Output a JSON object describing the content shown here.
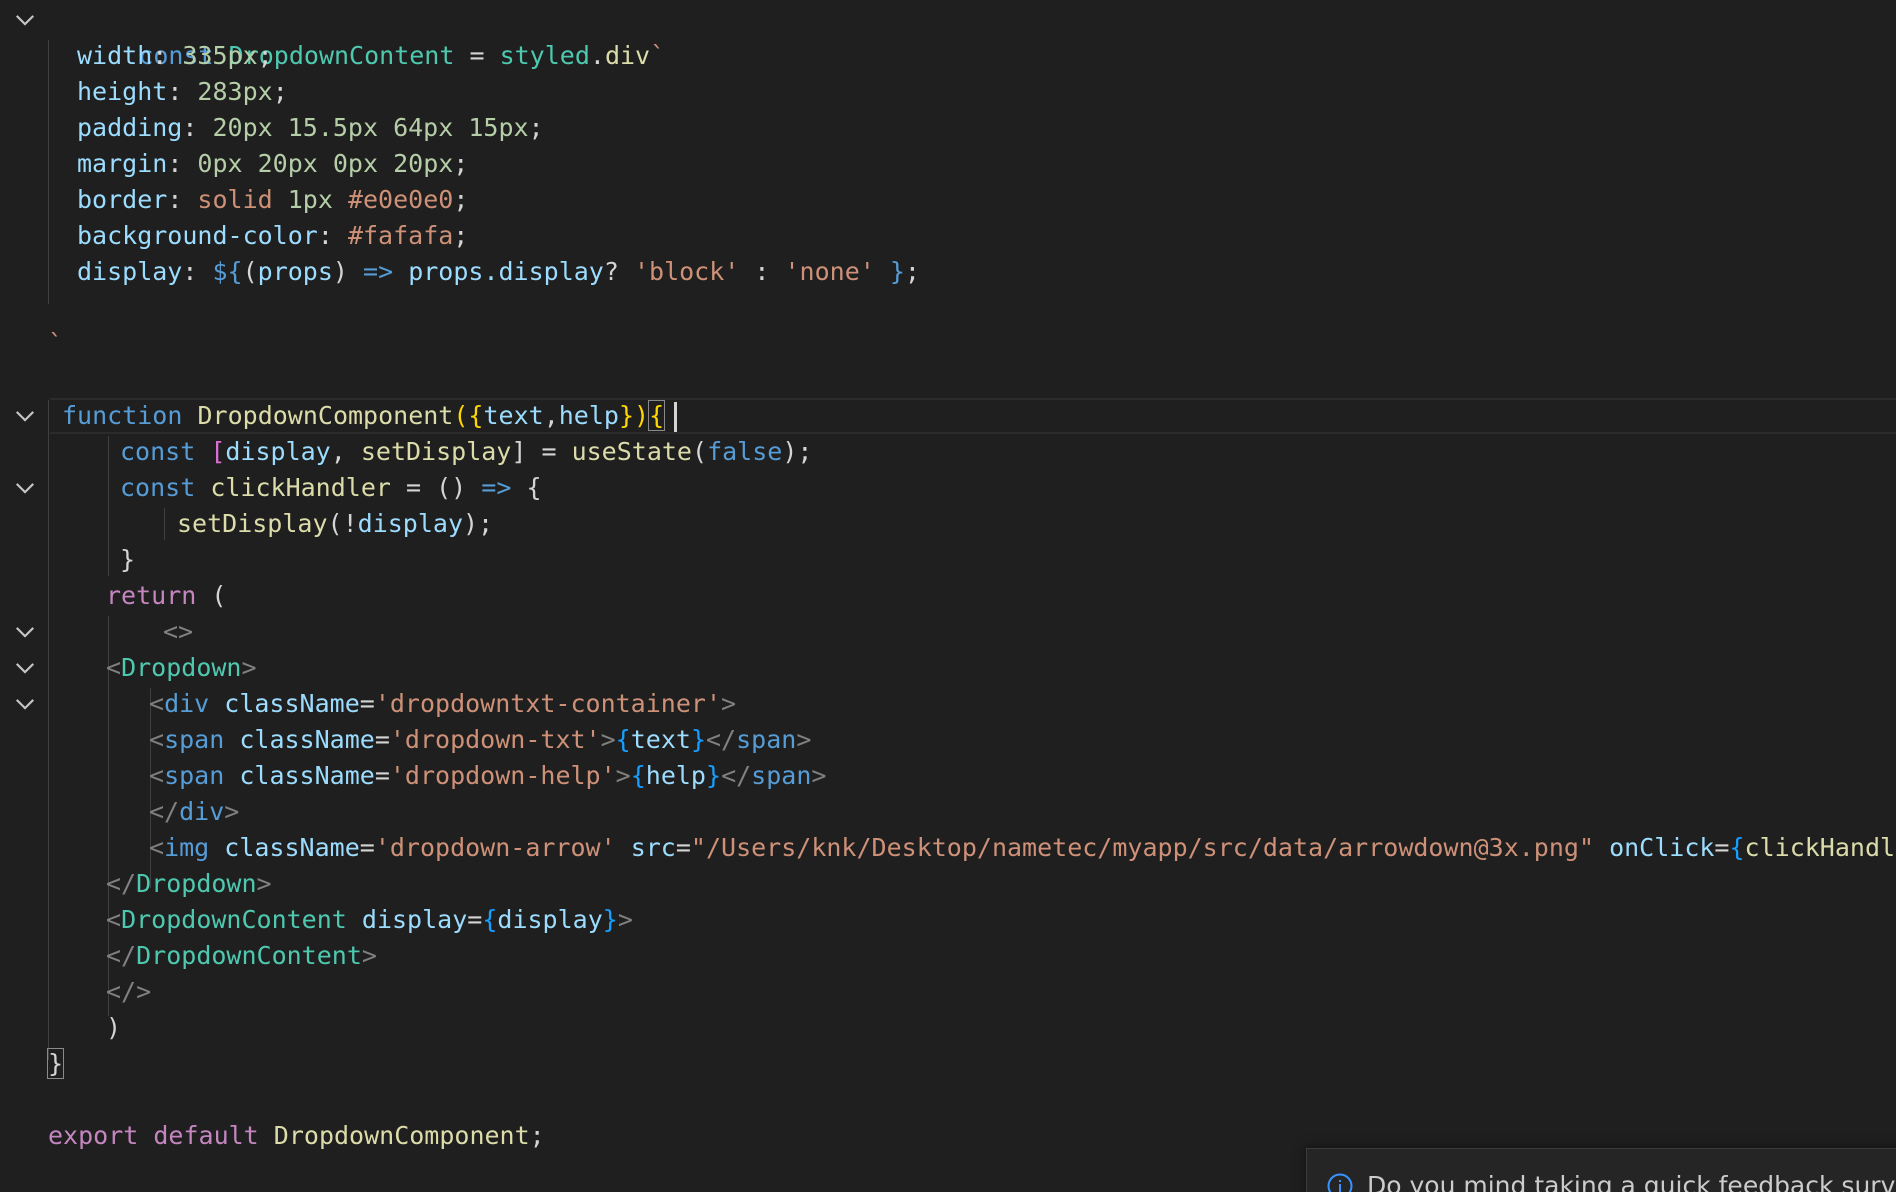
{
  "editor": {
    "styled_block": {
      "l1": {
        "kw": "const",
        "name": "DropdownContent",
        "eq": " = ",
        "obj": "styled",
        "dot": ".",
        "prop": "div",
        "tick": "`"
      },
      "props": [
        {
          "name": "width",
          "sep": ": ",
          "vals": [
            {
              "t": "num",
              "v": "335px"
            }
          ],
          "end": ";"
        },
        {
          "name": "height",
          "sep": ": ",
          "vals": [
            {
              "t": "num",
              "v": "283px"
            }
          ],
          "end": ";"
        },
        {
          "name": "padding",
          "sep": ": ",
          "vals": [
            {
              "t": "num",
              "v": "20px 15.5px 64px 15px"
            }
          ],
          "end": ";"
        },
        {
          "name": "margin",
          "sep": ": ",
          "vals": [
            {
              "t": "num",
              "v": "0px 20px 0px 20px"
            }
          ],
          "end": ";"
        },
        {
          "name": "border",
          "sep": ": ",
          "vals": [
            {
              "t": "str",
              "v": "solid "
            },
            {
              "t": "num",
              "v": "1px "
            },
            {
              "t": "str",
              "v": "#e0e0e0"
            }
          ],
          "end": ";"
        },
        {
          "name": "background-color",
          "sep": ": ",
          "vals": [
            {
              "t": "str",
              "v": "#fafafa"
            }
          ],
          "end": ";"
        }
      ],
      "display_line": {
        "name": "display",
        "sep": ": ",
        "dollar": "${",
        "paren_open": "(",
        "param": "props",
        "paren_close": ")",
        "arrow": " => ",
        "expr": "props.display",
        "q": "? ",
        "v1": "'block'",
        "colon": " : ",
        "v2": "'none'",
        "close": " }",
        "end": ";"
      },
      "closing_tick": "`"
    },
    "component": {
      "fn_kw": "function",
      "fn_name": "DropdownComponent",
      "params_open": "({",
      "p1": "text",
      "comma": ",",
      "p2": "help",
      "params_close": "})",
      "brace": "{",
      "state_line": {
        "kw": "const",
        "lb": " [",
        "a": "display",
        "c": ", ",
        "b": "setDisplay",
        "rb": "] = ",
        "fn": "useState",
        "po": "(",
        "arg": "false",
        "pc": ");"
      },
      "handler_line": {
        "kw": "const",
        "name": "clickHandler",
        "eq": " = ",
        "params": "()",
        "arrow": " => ",
        "brace": "{"
      },
      "handler_body": {
        "fn": "setDisplay",
        "po": "(",
        "not": "!",
        "arg": "display",
        "pc": ");"
      },
      "handler_close": "}",
      "return_kw": "return",
      "return_paren": " (",
      "frag_open": "<>",
      "dropdown_open": {
        "lt": "<",
        "tag": "Dropdown",
        "gt": ">"
      },
      "div_open": {
        "lt": "<",
        "tag": "div",
        "attr": "className",
        "eq": "=",
        "val": "'dropdowntxt-container'",
        "gt": ">"
      },
      "span1": {
        "lt": "<",
        "tag": "span",
        "attr": "className",
        "eq": "=",
        "val": "'dropdown-txt'",
        "gt": ">",
        "bo": "{",
        "expr": "text",
        "bc": "}",
        "close_lt": "</",
        "close_tag": "span",
        "close_gt": ">"
      },
      "span2": {
        "lt": "<",
        "tag": "span",
        "attr": "className",
        "eq": "=",
        "val": "'dropdown-help'",
        "gt": ">",
        "bo": "{",
        "expr": "help",
        "bc": "}",
        "close_lt": "</",
        "close_tag": "span",
        "close_gt": ">"
      },
      "div_close": {
        "lt": "</",
        "tag": "div",
        "gt": ">"
      },
      "img": {
        "lt": "<",
        "tag": "img",
        "attr1": "className",
        "eq1": "=",
        "val1": "'dropdown-arrow'",
        "attr2": "src",
        "eq2": "=",
        "val2": "\"/Users/knk/Desktop/nametec/myapp/src/data/arrowdown@3x.png\"",
        "attr3": "onClick",
        "eq3": "=",
        "bo": "{",
        "expr": "clickHandler",
        "bc": "}",
        "end": "/>"
      },
      "dropdown_close": {
        "lt": "</",
        "tag": "Dropdown",
        "gt": ">"
      },
      "content_open": {
        "lt": "<",
        "tag": "DropdownContent",
        "attr": "display",
        "eq": "=",
        "bo": "{",
        "expr": "display",
        "bc": "}",
        "gt": ">"
      },
      "content_close": {
        "lt": "</",
        "tag": "DropdownContent",
        "gt": ">"
      },
      "frag_close": "</>",
      "return_close": ")",
      "fn_close": "}"
    },
    "export_line": {
      "kw1": "export",
      "kw2": " default",
      "name": " DropdownComponent",
      "end": ";"
    }
  },
  "notification": {
    "icon": "info-icon",
    "text": "Do you mind taking a quick feedback survey?"
  }
}
